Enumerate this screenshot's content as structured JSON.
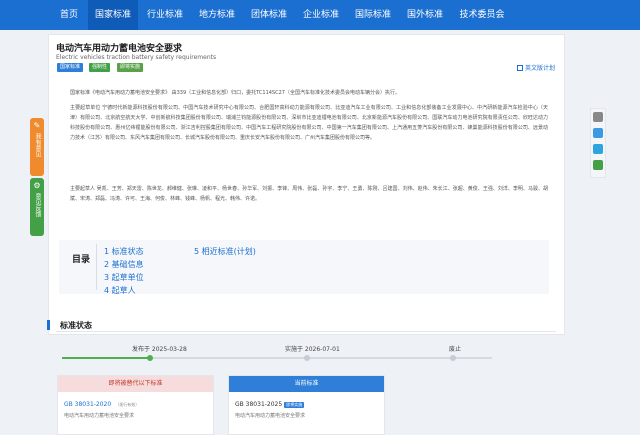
{
  "nav": {
    "items": [
      "首页",
      "国家标准",
      "行业标准",
      "地方标准",
      "团体标准",
      "企业标准",
      "国际标准",
      "国外标准",
      "技术委员会"
    ]
  },
  "standard": {
    "title": "电动汽车用动力蓄电池安全要求",
    "subtitle": "Electric vehicles traction battery safety requirements",
    "tags": [
      "国家标准",
      "强制性",
      "即将实施"
    ],
    "en_read": "英文版计划"
  },
  "content": {
    "para1": "国家标准《电动汽车用动力蓄电池安全要求》 由339（工业和信息化部）归口，委托TC114SC27（全国汽车标准化技术委员会电动车辆分会）执行。",
    "para2": "主要起草单位 宁德时代新能源科技股份有限公司、中国汽车技术研究中心有限公司、合肥国轩高科动力能源有限公司、比亚迪汽车工业有限公司、工业和信息化部装备工业发展中心、中汽研新能源汽车检验中心（天津）有限公司、北京航空航天大学、中创新航科技集团股份有限公司、瑞浦兰钧能源股份有限公司、深圳市比亚迪锂电池有限公司、北京新能源汽车股份有限公司、国联汽车动力电池研究院有限责任公司、欣旺达动力科技股份有限公司、惠州亿纬锂能股份有限公司、浙江吉利控股集团有限公司、中国汽车工程研究院股份有限公司、中国第一汽车集团有限公司、上汽通用五菱汽车股份有限公司、蜂巢能源科技股份有限公司、远景动力技术（江苏）有限公司、东风汽车集团有限公司、长城汽车股份有限公司、重庆长安汽车股份有限公司、广州汽车集团股份有限公司等。",
    "para3": "主要起草人 吴凯、王芳、郑天雷、陈世龙、郝维健、张琳、凌和平、杨世春、孙华军、刘振、李锋、周伟、张磊、孙宇、李宁、王勇、陈刚、吕建国、刘伟、赵伟、朱长江、张超、黄俊、王强、刘洋、李明、马骏、胡斌、宋涛、郑磊、冯涛、许可、王海、何俊、林峰、钱峰、杨帆、程光、韩伟、许诺。"
  },
  "toc": {
    "title": "目录",
    "items": [
      "1 标准状态",
      "2 基础信息",
      "3 起草单位",
      "4 起草人",
      "5 相近标准(计划)"
    ]
  },
  "status": {
    "section_title": "标准状态",
    "published": "发布于 2025-03-28",
    "implemented": "实施于 2026-07-01",
    "abolished": "废止",
    "progress_fraction": 0.2,
    "old": {
      "label": "即将被替代以下标准",
      "code": "GB 38031-2020",
      "badge": "（现行有效）",
      "name": "电动汽车用动力蓄电池安全要求"
    },
    "current": {
      "label": "当前标准",
      "code": "GB 38031-2025",
      "badge": "即将实施",
      "name": "电动汽车用动力蓄电池安全要求"
    }
  },
  "side": {
    "feedback": "我有意见",
    "report": "意见反馈"
  },
  "colors": {
    "primary": "#1b6fd1",
    "progress": "#4caf50",
    "warning": "#ef8b2c",
    "success": "#43a047"
  }
}
